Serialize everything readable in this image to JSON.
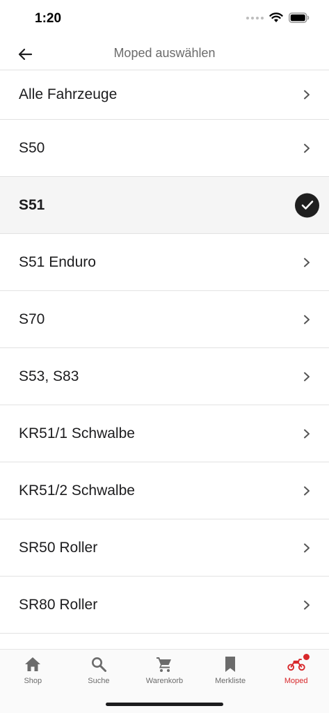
{
  "status_bar": {
    "time": "1:20"
  },
  "header": {
    "title": "Moped auswählen"
  },
  "list": {
    "items": [
      {
        "label": "Alle Fahrzeuge",
        "selected": false
      },
      {
        "label": "S50",
        "selected": false
      },
      {
        "label": "S51",
        "selected": true
      },
      {
        "label": "S51 Enduro",
        "selected": false
      },
      {
        "label": "S70",
        "selected": false
      },
      {
        "label": "S53, S83",
        "selected": false
      },
      {
        "label": "KR51/1 Schwalbe",
        "selected": false
      },
      {
        "label": "KR51/2 Schwalbe",
        "selected": false
      },
      {
        "label": "SR50 Roller",
        "selected": false
      },
      {
        "label": "SR80 Roller",
        "selected": false
      }
    ]
  },
  "tab_bar": {
    "tabs": [
      {
        "label": "Shop",
        "icon": "home-icon",
        "active": false
      },
      {
        "label": "Suche",
        "icon": "search-icon",
        "active": false
      },
      {
        "label": "Warenkorb",
        "icon": "cart-icon",
        "active": false
      },
      {
        "label": "Merkliste",
        "icon": "bookmark-icon",
        "active": false
      },
      {
        "label": "Moped",
        "icon": "moped-icon",
        "active": true
      }
    ]
  },
  "colors": {
    "accent": "#d8282b",
    "text": "#1c1c1e",
    "muted": "#6b6b6b",
    "selected_bg": "#f5f5f5"
  }
}
